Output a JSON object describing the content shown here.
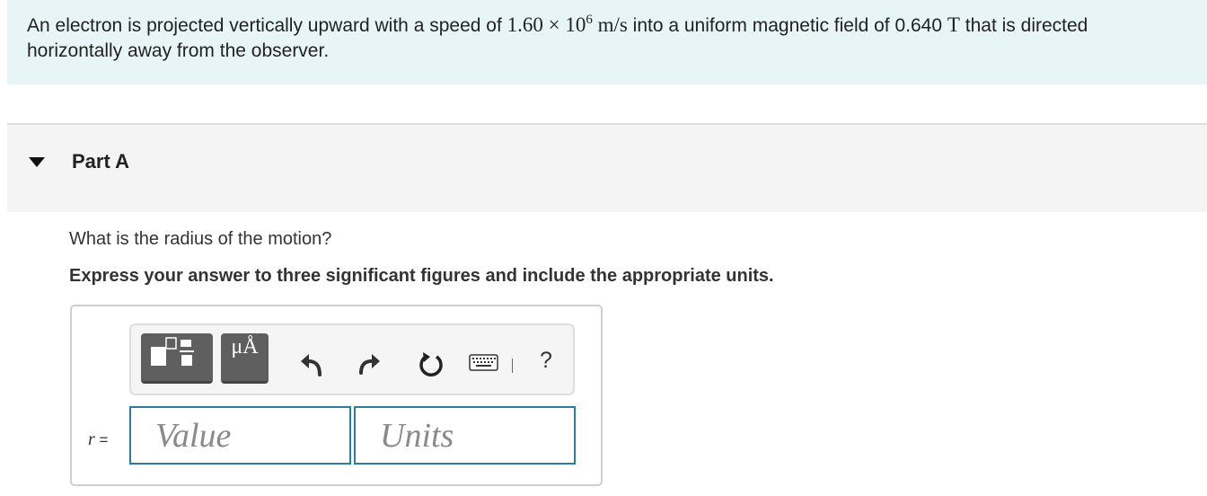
{
  "problem": {
    "text_before": "An electron is projected vertically upward with a speed of ",
    "speed_mantissa": "1.60",
    "times": "×",
    "speed_base": "10",
    "speed_exponent": "6",
    "speed_unit": "m/s",
    "text_middle": " into a uniform magnetic field of 0.640 ",
    "field_unit": "T",
    "text_after": " that is directed horizontally away from the observer."
  },
  "part": {
    "title": "Part A",
    "question": "What is the radius of the motion?",
    "instruction": "Express your answer to three significant figures and include the appropriate units."
  },
  "answer": {
    "variable": "r",
    "equals": "=",
    "value_placeholder": "Value",
    "units_placeholder": "Units",
    "value": "",
    "units": ""
  },
  "toolbar": {
    "units_button_label": "μÅ",
    "help_label": "?",
    "separator": "|"
  },
  "colors": {
    "problem_background": "#e7f5f6",
    "part_header_background": "#f4f4f4",
    "input_border": "#2c7c9a",
    "toolbar_button": "#5f5f5f"
  },
  "icons": [
    "caret-down-icon",
    "templates-icon",
    "units-icon",
    "undo-icon",
    "redo-icon",
    "reset-icon",
    "keyboard-icon",
    "help-icon"
  ]
}
